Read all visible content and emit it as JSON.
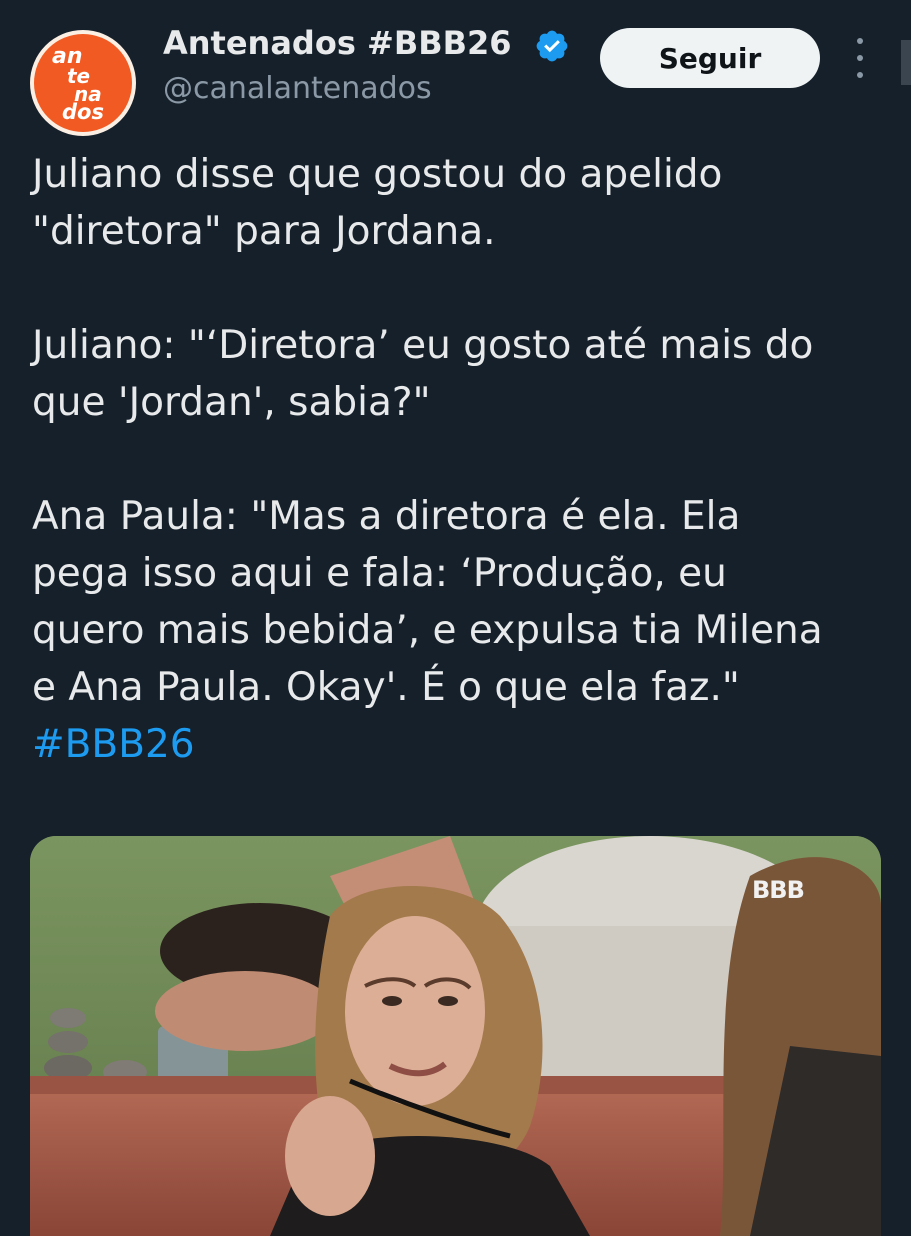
{
  "account": {
    "display_name": "Antenados #BBB26",
    "handle": "@canalantenados",
    "avatar_logo_text": [
      "an",
      "te",
      "na",
      "dos"
    ],
    "verified_color": "#1d9bf0"
  },
  "actions": {
    "follow_label": "Seguir"
  },
  "tweet": {
    "lines": [
      "Juliano disse que gostou do apelido",
      "\"diretora\" para Jordana.",
      "Juliano: \"‘Diretora’ eu gosto até mais do",
      "que 'Jordan', sabia?\"",
      "Ana Paula: \"Mas a diretora é ela. Ela",
      "pega isso aqui e fala: ‘Produção, eu",
      "quero mais bebida’, e expulsa tia Milena",
      "e Ana Paula. Okay'. É o que ela faz.\""
    ],
    "hashtag": "#BBB26"
  },
  "media": {
    "watermark": "BBB"
  },
  "colors": {
    "background": "#15202b",
    "text": "#e7e9ea",
    "secondary": "#8b98a5",
    "link": "#1d9bf0",
    "brand_orange": "#f15a22"
  }
}
